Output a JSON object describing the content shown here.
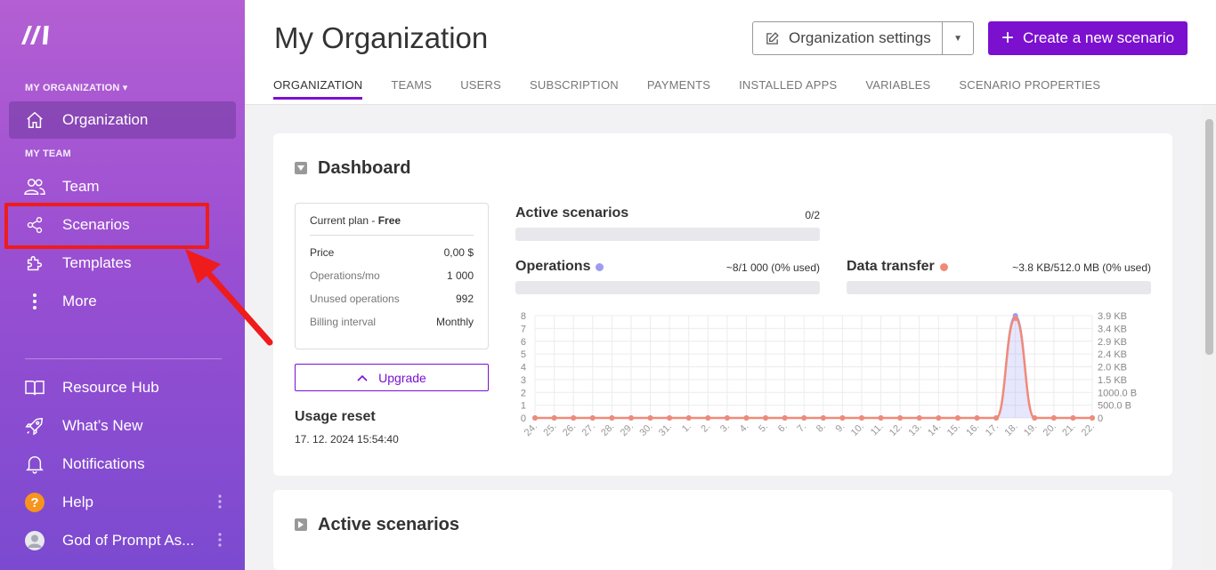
{
  "sidebar": {
    "org_section": "MY ORGANIZATION",
    "team_section": "MY TEAM",
    "items": {
      "organization": "Organization",
      "team": "Team",
      "scenarios": "Scenarios",
      "templates": "Templates",
      "more": "More",
      "resource_hub": "Resource Hub",
      "whats_new": "What’s New",
      "notifications": "Notifications",
      "help": "Help",
      "user": "God of Prompt As..."
    }
  },
  "header": {
    "title": "My Organization",
    "org_settings_label": "Organization settings",
    "create_label": "Create a new scenario",
    "tabs": [
      "ORGANIZATION",
      "TEAMS",
      "USERS",
      "SUBSCRIPTION",
      "PAYMENTS",
      "INSTALLED APPS",
      "VARIABLES",
      "SCENARIO PROPERTIES"
    ]
  },
  "dashboard": {
    "title": "Dashboard",
    "plan": {
      "head_prefix": "Current plan - ",
      "head_name": "Free",
      "rows": [
        {
          "label": "Price",
          "value": "0,00 $"
        },
        {
          "label": "Operations/mo",
          "value": "1 000"
        },
        {
          "label": "Unused operations",
          "value": "992"
        },
        {
          "label": "Billing interval",
          "value": "Monthly"
        }
      ]
    },
    "upgrade_label": "Upgrade",
    "usage_reset_label": "Usage reset",
    "usage_reset_date": "17. 12. 2024 15:54:40",
    "active_scenarios_label": "Active scenarios",
    "active_scenarios_value": "0/2",
    "operations_label": "Operations",
    "operations_value": "~8/1 000 (0% used)",
    "data_transfer_label": "Data transfer",
    "data_transfer_value": "~3.8 KB/512.0 MB (0% used)"
  },
  "active_scenarios_section": {
    "title": "Active scenarios"
  },
  "colors": {
    "accent": "#7b10cf",
    "operations": "#9b9cf2",
    "data_transfer": "#f08a78",
    "highlight": "#ee1c1c"
  },
  "chart_data": {
    "type": "line",
    "categories": [
      "24.",
      "25.",
      "26.",
      "27.",
      "28.",
      "29.",
      "30.",
      "31.",
      "1.",
      "2.",
      "3.",
      "4.",
      "5.",
      "6.",
      "7.",
      "8.",
      "9.",
      "10.",
      "11.",
      "12.",
      "13.",
      "14.",
      "15.",
      "16.",
      "17.",
      "18.",
      "19.",
      "20.",
      "21.",
      "22."
    ],
    "series": [
      {
        "name": "Operations",
        "axis": "left",
        "values": [
          0,
          0,
          0,
          0,
          0,
          0,
          0,
          0,
          0,
          0,
          0,
          0,
          0,
          0,
          0,
          0,
          0,
          0,
          0,
          0,
          0,
          0,
          0,
          0,
          0,
          8,
          0,
          0,
          0,
          0
        ]
      },
      {
        "name": "Data transfer",
        "axis": "right",
        "values": [
          0,
          0,
          0,
          0,
          0,
          0,
          0,
          0,
          0,
          0,
          0,
          0,
          0,
          0,
          0,
          0,
          0,
          0,
          0,
          0,
          0,
          0,
          0,
          0,
          0,
          3.8,
          0,
          0,
          0,
          0
        ]
      }
    ],
    "y_left_ticks": [
      "8",
      "7",
      "6",
      "5",
      "4",
      "3",
      "2",
      "1",
      "0"
    ],
    "y_right_ticks": [
      "3.9 KB",
      "3.4 KB",
      "2.9 KB",
      "2.4 KB",
      "2.0 KB",
      "1.5 KB",
      "1000.0 B",
      "500.0 B",
      "0"
    ],
    "ylim_left": [
      0,
      8
    ],
    "grid": true
  }
}
